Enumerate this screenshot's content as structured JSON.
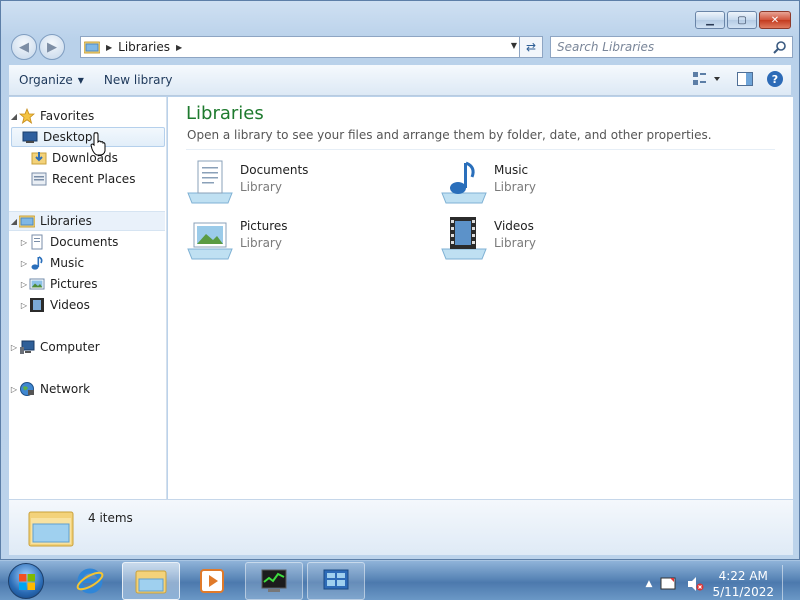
{
  "window": {
    "caption_minimize": "▁",
    "caption_maximize": "▢",
    "caption_close": "✕"
  },
  "address_bar": {
    "breadcrumb": "Libraries",
    "search_placeholder": "Search Libraries"
  },
  "toolbar": {
    "organize_label": "Organize",
    "new_library_label": "New library"
  },
  "nav_pane": {
    "favorites_label": "Favorites",
    "favorites_items": [
      "Desktop",
      "Downloads",
      "Recent Places"
    ],
    "libraries_label": "Libraries",
    "libraries_items": [
      "Documents",
      "Music",
      "Pictures",
      "Videos"
    ],
    "computer_label": "Computer",
    "network_label": "Network"
  },
  "content": {
    "title": "Libraries",
    "subtitle": "Open a library to see your files and arrange them by folder, date, and other properties.",
    "items": [
      {
        "name": "Documents",
        "type": "Library",
        "icon": "documents-library-icon"
      },
      {
        "name": "Music",
        "type": "Library",
        "icon": "music-library-icon"
      },
      {
        "name": "Pictures",
        "type": "Library",
        "icon": "pictures-library-icon"
      },
      {
        "name": "Videos",
        "type": "Library",
        "icon": "videos-library-icon"
      }
    ]
  },
  "details": {
    "item_count": "4 items"
  },
  "taskbar": {
    "clock_time": "4:22 AM",
    "clock_date": "5/11/2022"
  },
  "colors": {
    "title_green": "#1e7a2e",
    "window_frame": "#b9d1ea",
    "taskbar": "#4c79ad"
  }
}
